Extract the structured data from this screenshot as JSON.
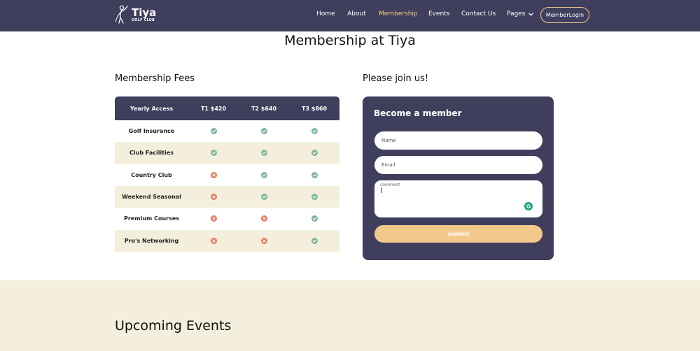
{
  "brand": {
    "name": "Tiya",
    "tagline": "GOLF CLUB"
  },
  "nav": {
    "items": [
      {
        "label": "Home",
        "active": false
      },
      {
        "label": "About",
        "active": false
      },
      {
        "label": "Membership",
        "active": true
      },
      {
        "label": "Events",
        "active": false
      },
      {
        "label": "Contact Us",
        "active": false
      },
      {
        "label": "Pages",
        "active": false
      }
    ],
    "member_button": "MemberLogin"
  },
  "page_title": "Membership at Tiya",
  "fees": {
    "heading": "Membership Fees",
    "columns": [
      "Yearly Access",
      "T1 $420",
      "T2 $640",
      "T3 $860"
    ],
    "rows": [
      {
        "label": "Golf Insurance",
        "tiers": [
          true,
          true,
          true
        ]
      },
      {
        "label": "Club Facilities",
        "tiers": [
          true,
          true,
          true
        ]
      },
      {
        "label": "Country Club",
        "tiers": [
          false,
          true,
          true
        ]
      },
      {
        "label": "Weekend Seasonal",
        "tiers": [
          false,
          true,
          true
        ]
      },
      {
        "label": "Premium Courses",
        "tiers": [
          false,
          false,
          true
        ]
      },
      {
        "label": "Pro's Networking",
        "tiers": [
          false,
          false,
          true
        ]
      }
    ]
  },
  "join": {
    "heading": "Please join us!",
    "form_title": "Become a member",
    "name_placeholder": "Name",
    "email_placeholder": "Email",
    "comment_placeholder": "comment",
    "submit_label": "submit"
  },
  "events": {
    "heading": "Upcoming Events"
  },
  "colors": {
    "nav_bg": "#3f3e5c",
    "accent": "#f3c98b",
    "band_bg": "#f4efdc",
    "yes": "#7fb69c",
    "no": "#e57a5c"
  }
}
